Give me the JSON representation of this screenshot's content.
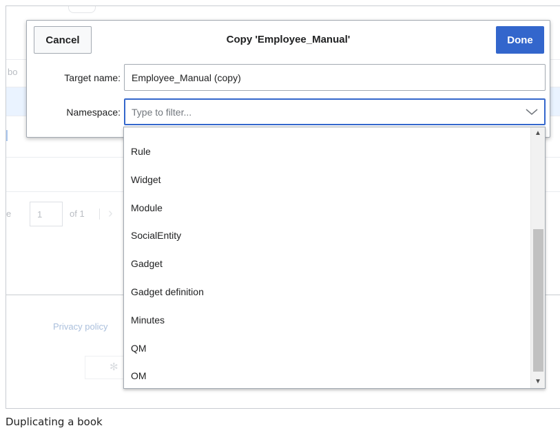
{
  "background": {
    "row_cut_text": "bo",
    "pagination": {
      "page_value": "1",
      "of_text": "of 1",
      "left_cut": "e"
    },
    "footer_link": "Privacy policy"
  },
  "dialog": {
    "title": "Copy 'Employee_Manual'",
    "cancel_label": "Cancel",
    "done_label": "Done",
    "target_name": {
      "label": "Target name:",
      "value": "Employee_Manual (copy)"
    },
    "namespace": {
      "label": "Namespace:",
      "placeholder": "Type to filter...",
      "value": ""
    }
  },
  "dropdown": {
    "items": [
      "Rule",
      "Widget",
      "Module",
      "SocialEntity",
      "Gadget",
      "Gadget definition",
      "Minutes",
      "QM",
      "OM"
    ],
    "scroll_fraction": 0.45
  },
  "caption": "Duplicating a book",
  "colors": {
    "accent": "#3366cc",
    "border": "#a2a9b1",
    "selected_row": "#eaf3ff"
  }
}
